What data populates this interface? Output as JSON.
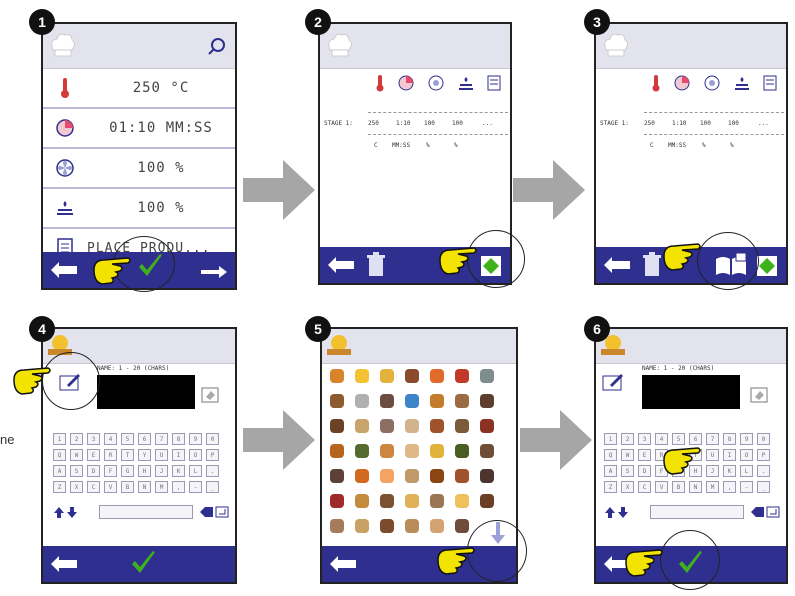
{
  "steps": [
    "1",
    "2",
    "3",
    "4",
    "5",
    "6"
  ],
  "screen1": {
    "rows": [
      "250 °C",
      "01:10 MM:SS",
      "100 %",
      "100 %",
      "PLACE PRODU..."
    ]
  },
  "stage_header": "STAGE 1:",
  "stage_values": [
    "250",
    "1:10",
    "100",
    "100",
    "..."
  ],
  "stage_units": [
    "C",
    "MM:SS",
    "%",
    "%"
  ],
  "name_label": "NAME: 1 - 20 (CHARS)",
  "side_text": "ne",
  "keyboard_rows": [
    [
      "1",
      "2",
      "3",
      "4",
      "5",
      "6",
      "7",
      "8",
      "9",
      "0"
    ],
    [
      "Q",
      "W",
      "E",
      "R",
      "T",
      "Y",
      "U",
      "I",
      "O",
      "P"
    ],
    [
      "A",
      "S",
      "D",
      "F",
      "G",
      "H",
      "J",
      "K",
      "L",
      "."
    ],
    [
      "Z",
      "X",
      "C",
      "V",
      "B",
      "N",
      "M",
      ",",
      "-",
      "_"
    ]
  ],
  "colors": {
    "bar": "#2f2f8f",
    "check": "#3fb11b",
    "hand": "#f2e400",
    "arrow": "#a6a6a6",
    "accent_red": "#cc2a2a"
  }
}
